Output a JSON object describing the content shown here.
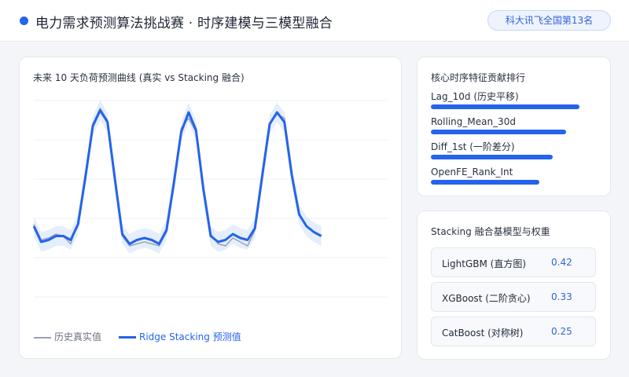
{
  "header": {
    "title": "电力需求预测算法挑战赛 · 时序建模与三模型融合",
    "badge": "科大讯飞全国第13名"
  },
  "chart_card": {
    "title": "未来 10 天负荷预测曲线 (真实 vs Stacking 融合)"
  },
  "chart_data": {
    "type": "line",
    "title": "未来 10 天负荷预测曲线 (真实 vs Stacking 融合)",
    "x": [
      0,
      1,
      2,
      3,
      4,
      5,
      6,
      7,
      8,
      9,
      10,
      11,
      12,
      13,
      14,
      15,
      16,
      17,
      18,
      19,
      20,
      21,
      22,
      23,
      24,
      25,
      26,
      27,
      28,
      29,
      30,
      31,
      32,
      33,
      34,
      35,
      36,
      37,
      38,
      39,
      40,
      41,
      42,
      43,
      44,
      45,
      46,
      47,
      48
    ],
    "ylim": [
      0,
      100
    ],
    "grid": true,
    "series": [
      {
        "name": "历史真实值",
        "values": [
          37,
          29,
          30,
          32,
          31,
          27,
          38,
          62,
          88,
          96,
          90,
          62,
          31,
          26,
          27,
          28,
          27,
          26,
          33,
          56,
          86,
          91,
          84,
          56,
          32,
          27,
          26,
          30,
          28,
          26,
          34,
          60,
          88,
          93,
          91,
          64
        ]
      },
      {
        "name": "Ridge Stacking 预测值",
        "values": [
          36,
          28,
          29,
          31,
          31,
          29,
          37,
          61,
          87,
          95,
          89,
          60,
          32,
          27,
          29,
          30,
          29,
          27,
          34,
          58,
          84,
          94,
          85,
          55,
          31,
          28,
          29,
          32,
          30,
          29,
          35,
          62,
          88,
          94,
          89,
          62,
          42,
          36,
          33,
          31
        ]
      }
    ],
    "legend_position": "bottom-left"
  },
  "legend": {
    "hist_label": "历史真实值",
    "pred_label": "Ridge Stacking 预测值"
  },
  "features": {
    "title": "核心时序特征贡献排行",
    "items": [
      {
        "label": "Lag_10d (历史平移)",
        "value": 0.88
      },
      {
        "label": "Rolling_Mean_30d",
        "value": 0.8
      },
      {
        "label": "Diff_1st (一阶差分)",
        "value": 0.72
      },
      {
        "label": "OpenFE_Rank_Int",
        "value": 0.64
      }
    ]
  },
  "stacking": {
    "title": "Stacking 融合基模型与权重",
    "models": [
      {
        "name": "LightGBM (直方图)",
        "weight": "0.42"
      },
      {
        "name": "XGBoost (二阶贪心)",
        "weight": "0.33"
      },
      {
        "name": "CatBoost (对称树)",
        "weight": "0.25"
      }
    ]
  },
  "colors": {
    "accent": "#2563eb",
    "history": "#9aa3b2",
    "band": "#dce8fb"
  }
}
